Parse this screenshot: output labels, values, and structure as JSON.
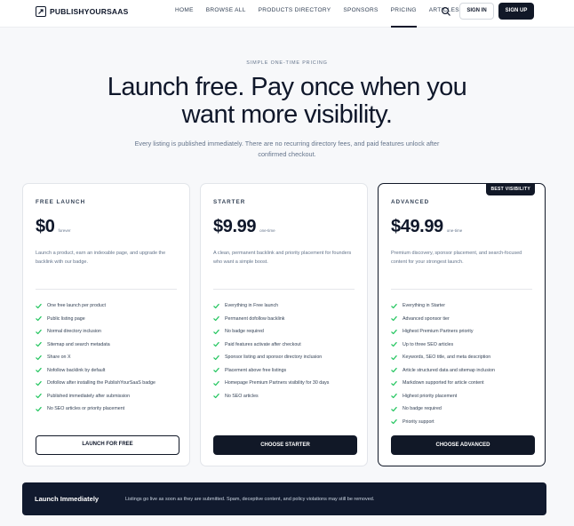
{
  "nav": {
    "brand": "PUBLISHYOURSAAS",
    "links": [
      "HOME",
      "BROWSE ALL",
      "PRODUCTS DIRECTORY",
      "SPONSORS",
      "PRICING",
      "ARTICLES"
    ],
    "active_link": "PRICING",
    "signin_label": "SIGN IN",
    "signup_label": "SIGN UP",
    "search_icon": "search-icon"
  },
  "hero": {
    "eyebrow": "SIMPLE ONE-TIME PRICING",
    "headline": "Launch free. Pay once when you want more visibility.",
    "subtext": "Every listing is published immediately. There are no recurring directory fees, and paid features unlock after confirmed checkout."
  },
  "plans": [
    {
      "label": "FREE LAUNCH",
      "price": "$0",
      "price_note": "forever",
      "description": "Launch a product, earn an indexable page, and upgrade the backlink with our badge.",
      "features": [
        "One free launch per product",
        "Public listing page",
        "Normal directory inclusion",
        "Sitemap and search metadata",
        "Share on X",
        "Nofollow backlink by default",
        "Dofollow after installing the PublishYourSaaS badge",
        "Published immediately after submission",
        "No SEO articles or priority placement"
      ],
      "cta": "LAUNCH FOR FREE"
    },
    {
      "label": "STARTER",
      "price": "$9.99",
      "price_note": "one-time",
      "description": "A clean, permanent backlink and priority placement for founders who want a simple boost.",
      "features": [
        "Everything in Free launch",
        "Permanent dofollow backlink",
        "No badge required",
        "Paid features activate after checkout",
        "Sponsor listing and sponsor directory inclusion",
        "Placement above free listings",
        "Homepage Premium Partners visibility for 30 days",
        "No SEO articles"
      ],
      "cta": "CHOOSE STARTER"
    },
    {
      "label": "ADVANCED",
      "badge": "BEST VISIBILITY",
      "price": "$49.99",
      "price_note": "one-time",
      "description": "Premium discovery, sponsor placement, and search-focused content for your strongest launch.",
      "features": [
        "Everything in Starter",
        "Advanced sponsor tier",
        "Highest Premium Partners priority",
        "Up to three SEO articles",
        "Keywords, SEO title, and meta description",
        "Article structured data and sitemap inclusion",
        "Markdown supported for article content",
        "Highest priority placement",
        "No badge required",
        "Priority support"
      ],
      "cta": "CHOOSE ADVANCED"
    }
  ],
  "banner": {
    "title": "Launch Immediately",
    "text": "Listings go live as soon as they are submitted. Spam, deceptive content, and policy violations may still be removed."
  },
  "colors": {
    "primary": "#111827",
    "check": "#22c55e",
    "background": "#f7f8fa"
  }
}
